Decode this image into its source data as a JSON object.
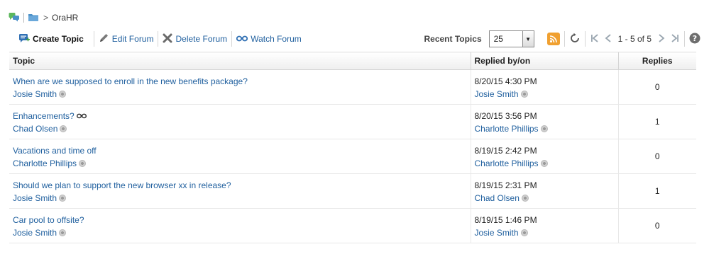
{
  "breadcrumb": {
    "separator": ">",
    "current": "OraHR"
  },
  "toolbar": {
    "create_topic": "Create Topic",
    "edit_forum": "Edit Forum",
    "delete_forum": "Delete Forum",
    "watch_forum": "Watch Forum",
    "recent_label": "Recent Topics",
    "recent_value": "25",
    "pagination": "1 - 5 of 5"
  },
  "table": {
    "headers": {
      "topic": "Topic",
      "replied": "Replied by/on",
      "replies": "Replies"
    },
    "rows": [
      {
        "title": "When are we supposed to enroll in the new benefits package?",
        "author": "Josie Smith",
        "date": "8/20/15 4:30 PM",
        "replied_by": "Josie Smith",
        "replies": "0",
        "watched": false
      },
      {
        "title": "Enhancements?",
        "author": "Chad Olsen",
        "date": "8/20/15 3:56 PM",
        "replied_by": "Charlotte Phillips",
        "replies": "1",
        "watched": true
      },
      {
        "title": "Vacations and time off",
        "author": "Charlotte Phillips",
        "date": "8/19/15 2:42 PM",
        "replied_by": "Charlotte Phillips",
        "replies": "0",
        "watched": false
      },
      {
        "title": "Should we plan to support the new browser xx in release?",
        "author": "Josie Smith",
        "date": "8/19/15 2:31 PM",
        "replied_by": "Chad Olsen",
        "replies": "1",
        "watched": false
      },
      {
        "title": "Car pool to offsite?",
        "author": "Josie Smith",
        "date": "8/19/15 1:46 PM",
        "replied_by": "Josie Smith",
        "replies": "0",
        "watched": false
      }
    ]
  },
  "colors": {
    "link": "#1f5f9e",
    "rss": "#f0a030"
  },
  "icons": [
    "discussions-icon",
    "forum-folder-icon",
    "create-topic-icon",
    "pencil-icon",
    "delete-x-icon",
    "glasses-icon",
    "rss-icon",
    "refresh-icon",
    "first-page-icon",
    "prev-page-icon",
    "next-page-icon",
    "last-page-icon",
    "help-icon",
    "presence-icon"
  ]
}
